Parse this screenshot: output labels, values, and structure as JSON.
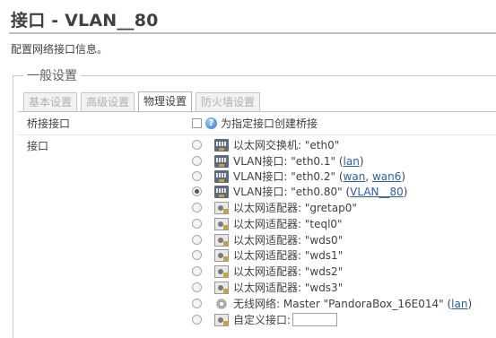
{
  "page": {
    "title": "接口 - VLAN__80",
    "description": "配置网络接口信息。"
  },
  "section": {
    "legend": "一般设置"
  },
  "tabs": [
    {
      "label": "基本设置"
    },
    {
      "label": "高级设置"
    },
    {
      "label": "物理设置"
    },
    {
      "label": "防火墙设置"
    }
  ],
  "bridge": {
    "label": "桥接接口",
    "checkbox_text": "为指定接口创建桥接"
  },
  "interfaces": {
    "label": "接口",
    "items": [
      {
        "text": "以太网交换机: \"eth0\"",
        "paren": "",
        "links": []
      },
      {
        "text": "VLAN接口: \"eth0.1\"",
        "links": [
          "lan"
        ]
      },
      {
        "text": "VLAN接口: \"eth0.2\"",
        "links": [
          "wan",
          "wan6"
        ]
      },
      {
        "text": "VLAN接口: \"eth0.80\"",
        "links": [
          "VLAN__80"
        ]
      },
      {
        "text": "以太网适配器: \"gretap0\"",
        "links": []
      },
      {
        "text": "以太网适配器: \"teql0\"",
        "links": []
      },
      {
        "text": "以太网适配器: \"wds0\"",
        "links": []
      },
      {
        "text": "以太网适配器: \"wds1\"",
        "links": []
      },
      {
        "text": "以太网适配器: \"wds2\"",
        "links": []
      },
      {
        "text": "以太网适配器: \"wds3\"",
        "links": []
      },
      {
        "text": "无线网络: Master \"PandoraBox_16E014\"",
        "links": [
          "lan"
        ]
      },
      {
        "text": "自定义接口:",
        "links": []
      }
    ],
    "selected_index": 3
  },
  "help_glyph": "?",
  "colors": {
    "link": "#2a5db0",
    "text": "#404040"
  }
}
